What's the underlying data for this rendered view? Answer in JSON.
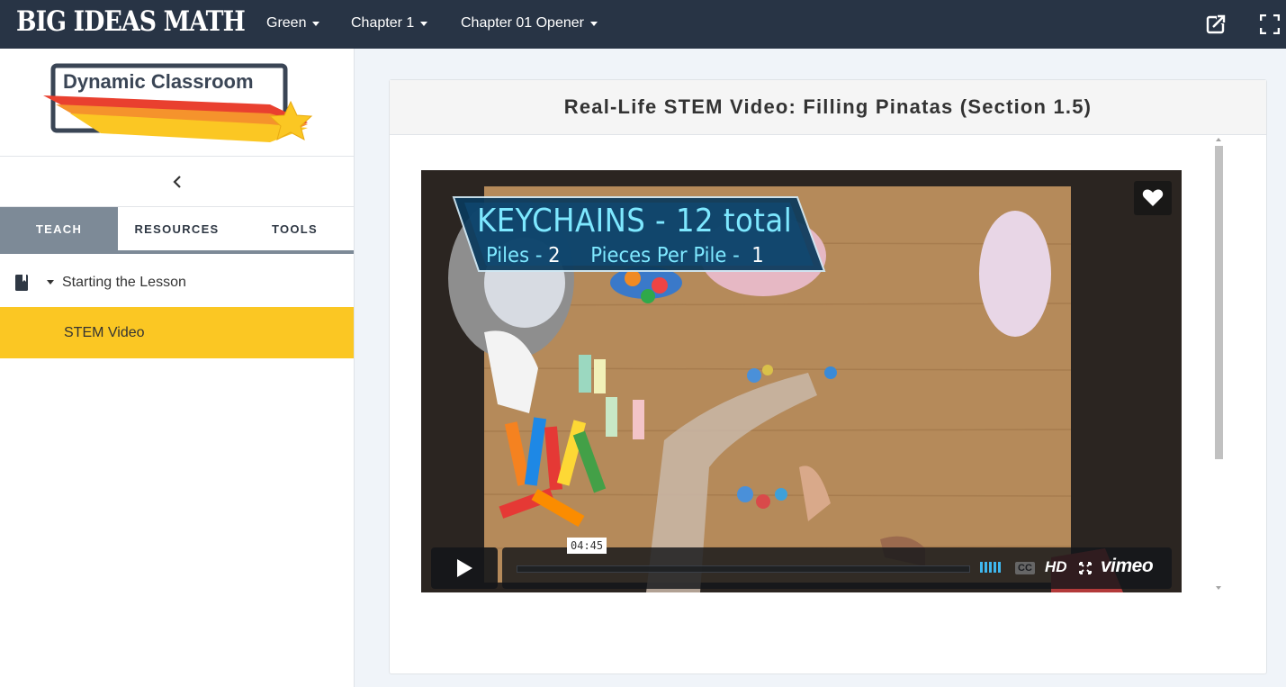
{
  "topbar": {
    "brand": "BIG IDEAS MATH",
    "course": "Green",
    "chapter": "Chapter 1",
    "section": "Chapter 01 Opener",
    "icons": [
      "external-link-icon",
      "fullscreen-icon"
    ]
  },
  "sidebar": {
    "logo_text": "Dynamic Classroom",
    "tabs": [
      {
        "label": "TEACH",
        "active": true
      },
      {
        "label": "RESOURCES",
        "active": false
      },
      {
        "label": "TOOLS",
        "active": false
      }
    ],
    "tree": {
      "group_label": "Starting the Lesson",
      "selected_item": "STEM Video"
    },
    "colors": {
      "accent": "#fbc723",
      "tab_active": "#7d8a97"
    }
  },
  "main": {
    "title": "Real-Life STEM Video: Filling Pinatas (Section 1.5)",
    "video": {
      "banner_heading": "KEYCHAINS",
      "banner_dash": "-",
      "banner_total": "12 total",
      "piles_label": "Piles -",
      "piles_value": "2",
      "per_pile_label": "Pieces Per Pile -",
      "per_pile_value": "1",
      "duration": "04:45",
      "hd_label": "HD",
      "cc_label": "CC",
      "player_brand": "vimeo"
    }
  },
  "colors": {
    "topbar": "#283445",
    "banner_text": "#7ee8ff",
    "volume": "#3fb7ee"
  }
}
